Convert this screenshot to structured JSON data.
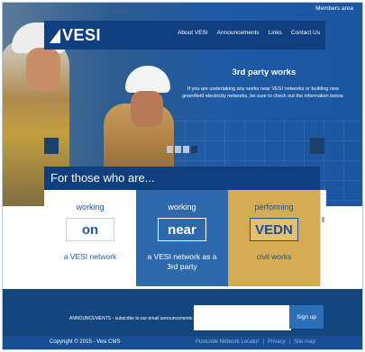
{
  "header": {
    "members_area": "Members area",
    "logo_text": "VESI",
    "nav": [
      "About VESI",
      "Announcements",
      "Links",
      "Contact Us"
    ]
  },
  "hero": {
    "title": "3rd party works",
    "text": "If you are undertaking any works near VESI networks or building new greenfield electricity networks, be sure to check out the information below."
  },
  "banner": {
    "title": "For those who are..."
  },
  "cards": [
    {
      "pre": "working",
      "key": "on",
      "post": "a VESI network"
    },
    {
      "pre": "working",
      "key": "near",
      "post": "a VESI network as a 3rd party"
    },
    {
      "pre": "performing",
      "key": "VEDN",
      "post": "civil works"
    }
  ],
  "footer": {
    "subscribe_label": "ANNOUNCEMENTS - subscribe to our email announcements",
    "email_placeholder": "",
    "signup_label": "Sign up",
    "copyright": "Copyright © 2015 - Vesi CMS",
    "links": [
      "Postcode Network Locator",
      "|",
      "Privacy",
      "|",
      "Site map"
    ]
  },
  "colors": {
    "dark_blue": "#0f3f7e",
    "mid_blue": "#2f69ad",
    "gold": "#d4ac54"
  }
}
